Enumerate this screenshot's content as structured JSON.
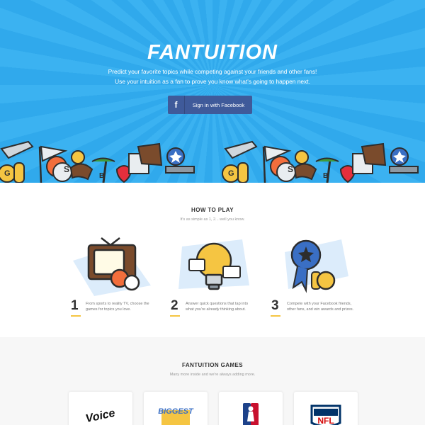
{
  "hero": {
    "logo": "FANTUITION",
    "tagline_1": "Predict your favorite topics while competing against your friends and other fans!",
    "tagline_2": "Use your intuition as a fan to prove you know what's going to happen next.",
    "facebook_button": "Sign in with Facebook",
    "facebook_glyph": "f",
    "colors": {
      "background": "#3bb2f1",
      "button": "#3f5a9a"
    }
  },
  "how_to_play": {
    "title": "HOW TO PLAY",
    "subtitle": "It's as simple as 1, 2... well you know.",
    "steps": [
      {
        "number": "1",
        "text": "From sports to reality TV, choose the games for topics you love."
      },
      {
        "number": "2",
        "text": "Answer quick questions that tap into what you're already thinking about."
      },
      {
        "number": "3",
        "text": "Compete with your Facebook friends, other fans, and win awards and prizes."
      }
    ]
  },
  "games": {
    "title": "FANTUITION GAMES",
    "subtitle": "Many more inside and we're always adding more.",
    "cards": [
      {
        "logo_text": "Voice"
      },
      {
        "logo_text": "BIGGEST"
      },
      {
        "logo_text": "NBA"
      },
      {
        "logo_text": "NFL"
      }
    ]
  }
}
